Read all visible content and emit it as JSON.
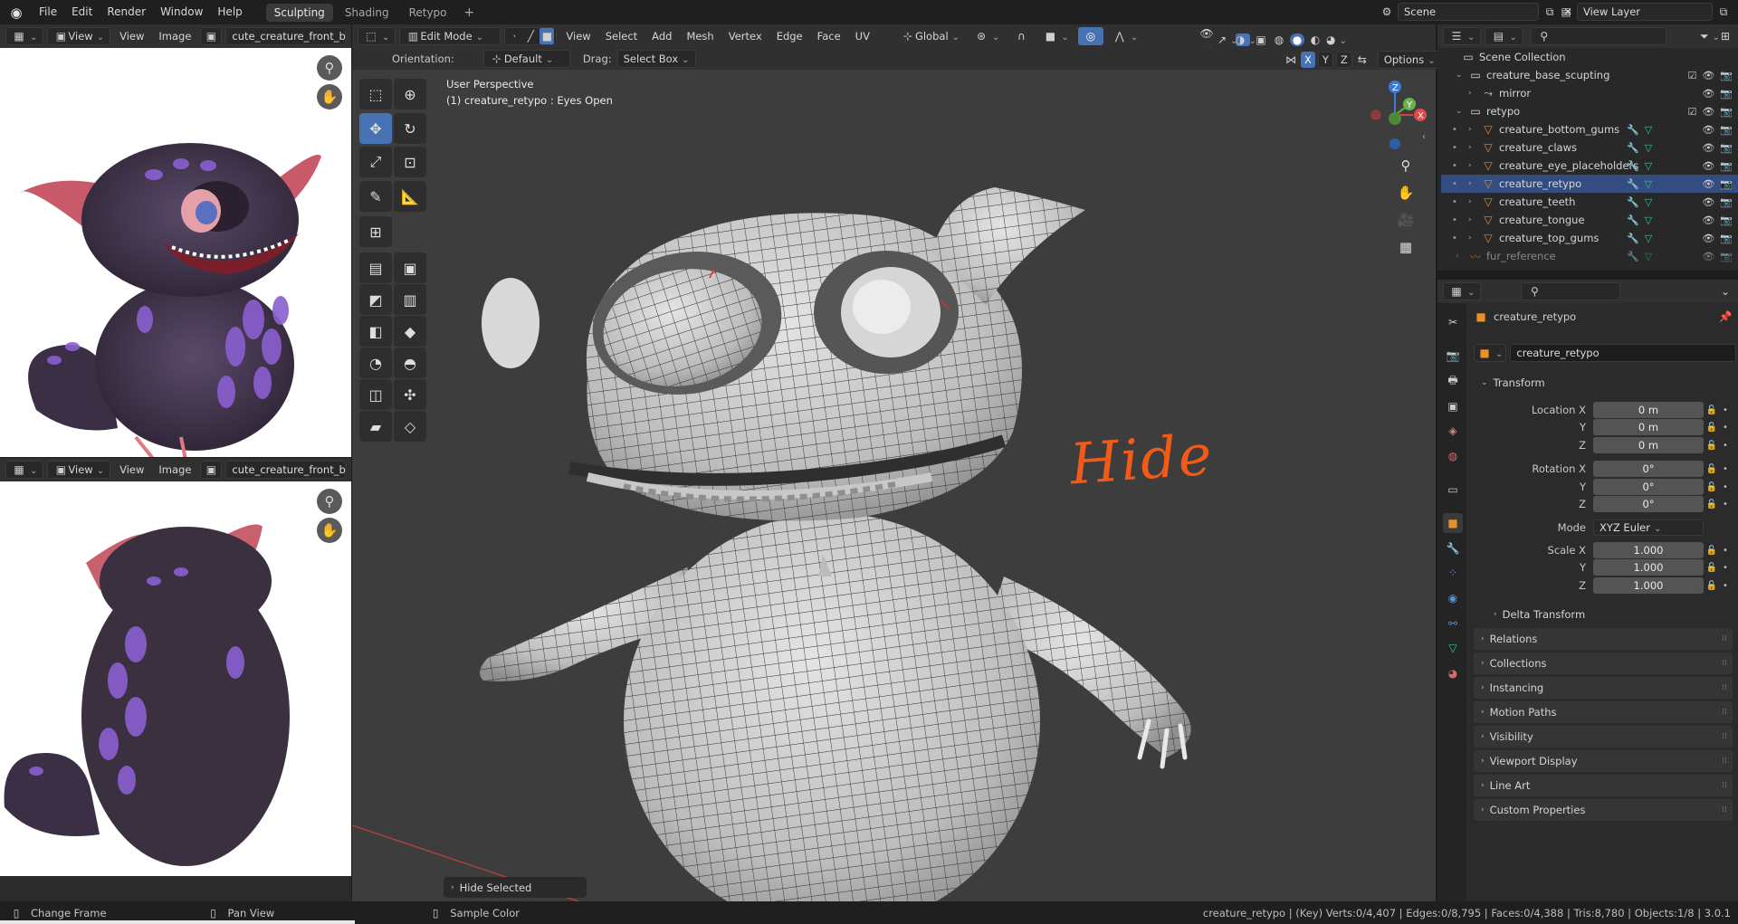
{
  "topbar": {
    "menus": [
      "File",
      "Edit",
      "Render",
      "Window",
      "Help"
    ],
    "workspaces": [
      "Sculpting",
      "Shading",
      "Retypo"
    ],
    "active_workspace": "Sculpting",
    "add_tab": "+",
    "scene": "Scene",
    "view_layer": "View Layer"
  },
  "image_editor_top": {
    "menu_view": "View",
    "view": "View",
    "image": "Image",
    "image_name": "cute_creature_front_back."
  },
  "image_editor_bottom": {
    "menu_view": "View",
    "view": "View",
    "image": "Image",
    "image_name": "cute_creature_front_back."
  },
  "viewport_header": {
    "mode": "Edit Mode",
    "menus": [
      "View",
      "Select",
      "Add",
      "Mesh",
      "Vertex",
      "Edge",
      "Face",
      "UV"
    ],
    "transform_orientation": "Global",
    "orientation_label": "Orientation:",
    "orientation_value": "Default",
    "drag_label": "Drag:",
    "drag_value": "Select Box",
    "axis_x": "X",
    "axis_y": "Y",
    "axis_z": "Z",
    "options": "Options"
  },
  "viewport": {
    "perspective": "User Perspective",
    "object_info": "(1) creature_retypo : Eyes Open",
    "annotation": "Hide",
    "last_operator": "Hide Selected",
    "annotation_color": "#f25a1a"
  },
  "outliner": {
    "search_placeholder": "",
    "root": "Scene Collection",
    "items": [
      {
        "label": "creature_base_scupting",
        "level": 1,
        "kind": "collection"
      },
      {
        "label": "mirror",
        "level": 2,
        "kind": "empty"
      },
      {
        "label": "retypo",
        "level": 1,
        "kind": "collection"
      },
      {
        "label": "creature_bottom_gums",
        "level": 2,
        "kind": "mesh"
      },
      {
        "label": "creature_claws",
        "level": 2,
        "kind": "mesh"
      },
      {
        "label": "creature_eye_placeholders",
        "level": 2,
        "kind": "mesh"
      },
      {
        "label": "creature_retypo",
        "level": 2,
        "kind": "mesh",
        "selected": true
      },
      {
        "label": "creature_teeth",
        "level": 2,
        "kind": "mesh"
      },
      {
        "label": "creature_tongue",
        "level": 2,
        "kind": "mesh"
      },
      {
        "label": "creature_top_gums",
        "level": 2,
        "kind": "mesh"
      },
      {
        "label": "fur_reference",
        "level": 1,
        "kind": "curve",
        "dim": true
      }
    ]
  },
  "properties": {
    "search_placeholder": "",
    "object_name": "creature_retypo",
    "object_field": "creature_retypo",
    "transform_title": "Transform",
    "location": {
      "label_x": "Location X",
      "label_y": "Y",
      "label_z": "Z",
      "x": "0 m",
      "y": "0 m",
      "z": "0 m"
    },
    "rotation": {
      "label_x": "Rotation X",
      "label_y": "Y",
      "label_z": "Z",
      "x": "0°",
      "y": "0°",
      "z": "0°"
    },
    "mode_label": "Mode",
    "mode_value": "XYZ Euler",
    "scale": {
      "label_x": "Scale X",
      "label_y": "Y",
      "label_z": "Z",
      "x": "1.000",
      "y": "1.000",
      "z": "1.000"
    },
    "delta_transform": "Delta Transform",
    "sections": [
      "Relations",
      "Collections",
      "Instancing",
      "Motion Paths",
      "Visibility",
      "Viewport Display",
      "Line Art",
      "Custom Properties"
    ]
  },
  "statusbar": {
    "left1": "Change Frame",
    "left2": "Pan View",
    "left3": "Sample Color",
    "stats": "creature_retypo | (Key) Verts:0/4,407 | Edges:0/8,795 | Faces:0/4,388 | Tris:8,780 | Objects:1/8 | 3.0.1"
  },
  "colors": {
    "accent": "#4772b3",
    "selection": "#334d80",
    "background": "#3d3d3d"
  }
}
